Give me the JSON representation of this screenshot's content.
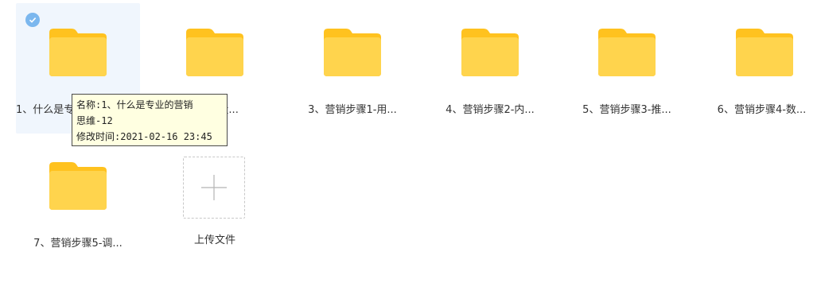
{
  "files": [
    {
      "label": "1、什么是专业的营销思维-12"
    },
    {
      "label": "2、流量..."
    },
    {
      "label": "3、营销步骤1-用..."
    },
    {
      "label": "4、营销步骤2-内..."
    },
    {
      "label": "5、营销步骤3-推..."
    },
    {
      "label": "6、营销步骤4-数..."
    },
    {
      "label": "7、营销步骤5-调..."
    }
  ],
  "upload": {
    "label": "上传文件",
    "icon": "plus-icon"
  },
  "tooltip": {
    "name_line1": "名称:1、什么是专业的营销",
    "name_line2": "思维-12",
    "modified": "修改时间:2021-02-16 23:45"
  },
  "colors": {
    "folder": "#ffd44d",
    "folder_tab": "#ffc21f",
    "selected_bg": "#f0f6fd",
    "check": "#7bb7ee"
  }
}
